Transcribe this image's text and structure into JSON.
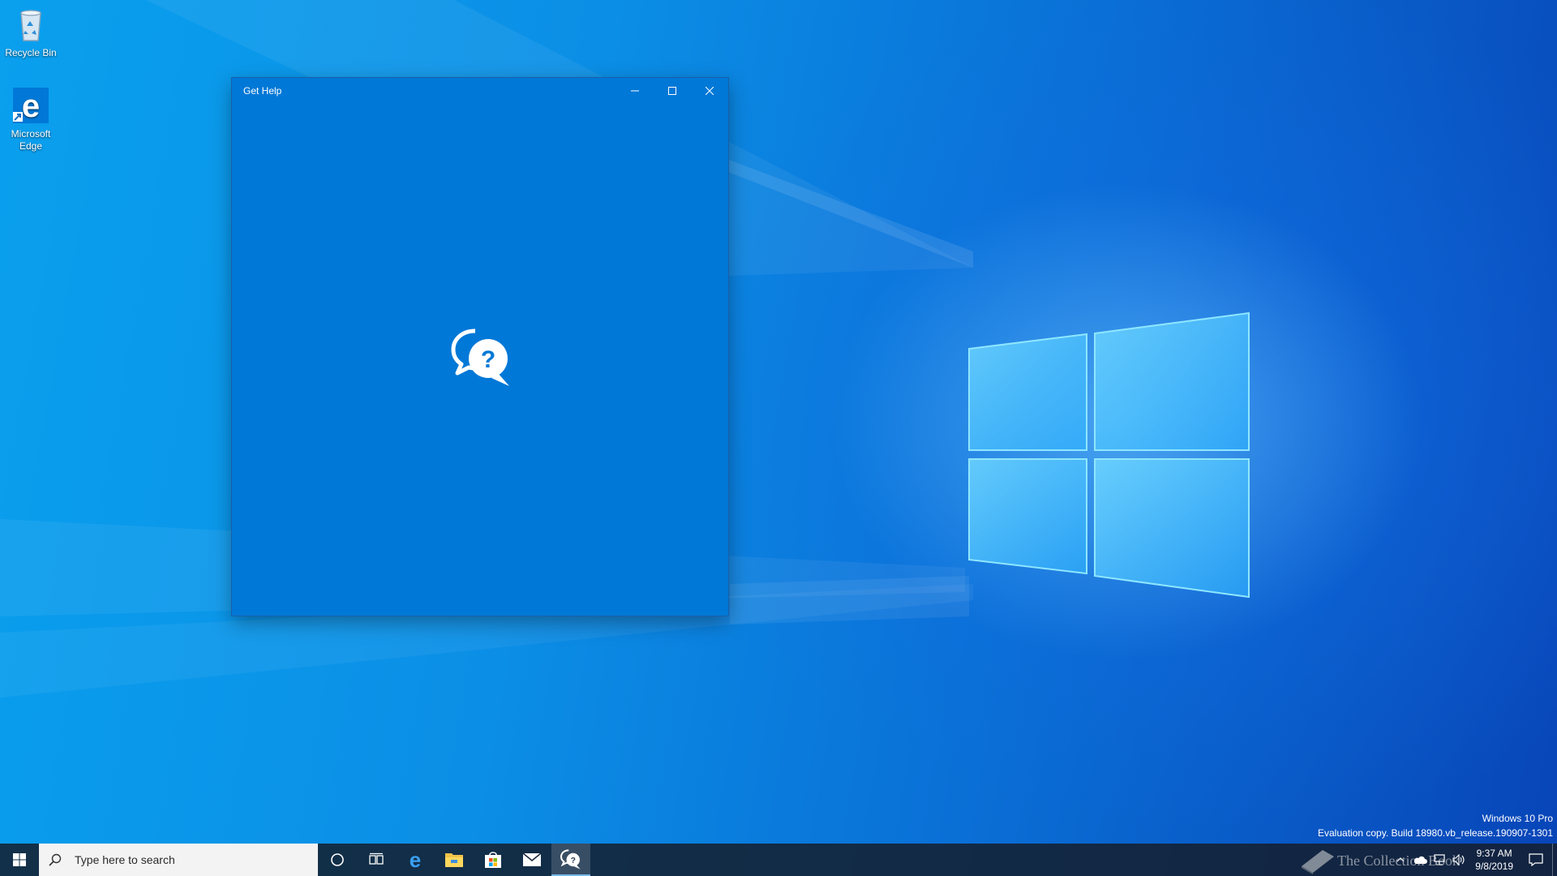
{
  "desktop": {
    "icons": [
      {
        "label": "Recycle Bin",
        "icon": "recycle-bin-icon"
      },
      {
        "label": "Microsoft Edge",
        "icon": "edge-icon"
      }
    ]
  },
  "window": {
    "title": "Get Help",
    "background": "#0078d7",
    "splash_icon": "help-chat-icon",
    "buttons": [
      "minimize-icon",
      "maximize-icon",
      "close-icon"
    ]
  },
  "watermark": {
    "edition": "Windows 10 Pro",
    "build": "Evaluation copy. Build 18980.vb_release.190907-1301"
  },
  "taskbar": {
    "search_placeholder": "Type here to search",
    "apps": [
      "cortana-icon",
      "task-view-icon",
      "edge-icon",
      "file-explorer-icon",
      "store-icon",
      "mail-icon",
      "get-help-icon"
    ],
    "active_app": "get-help-icon",
    "overlay_text": "The Collection Book",
    "clock": {
      "time": "9:37 AM",
      "date": "9/8/2019"
    }
  }
}
